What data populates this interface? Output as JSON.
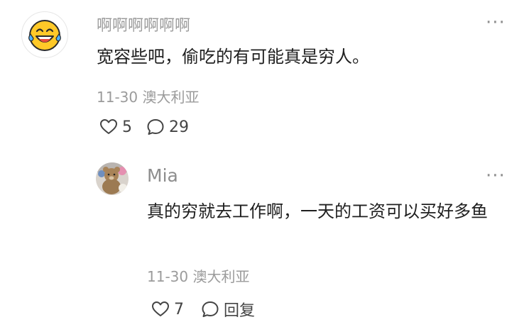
{
  "comment": {
    "username": "啊啊啊啊啊啊",
    "content": "宽容些吧，偷吃的有可能真是穷人。",
    "date": "11-30",
    "location": "澳大利亚",
    "like_count": "5",
    "reply_count": "29",
    "avatar_icon": "laughing-tears-emoji-icon"
  },
  "reply": {
    "username": "Mia",
    "content": "真的穷就去工作啊，一天的工资可以买好多鱼",
    "date": "11-30",
    "location": "澳大利亚",
    "like_count": "7",
    "reply_label": "回复",
    "avatar_icon": "plush-toy-photo"
  },
  "icons": {
    "more": "···"
  },
  "colors": {
    "meta_text": "#9b9b9b",
    "body_text": "#1f1f1f",
    "emoji_yellow": "#ffc928"
  }
}
